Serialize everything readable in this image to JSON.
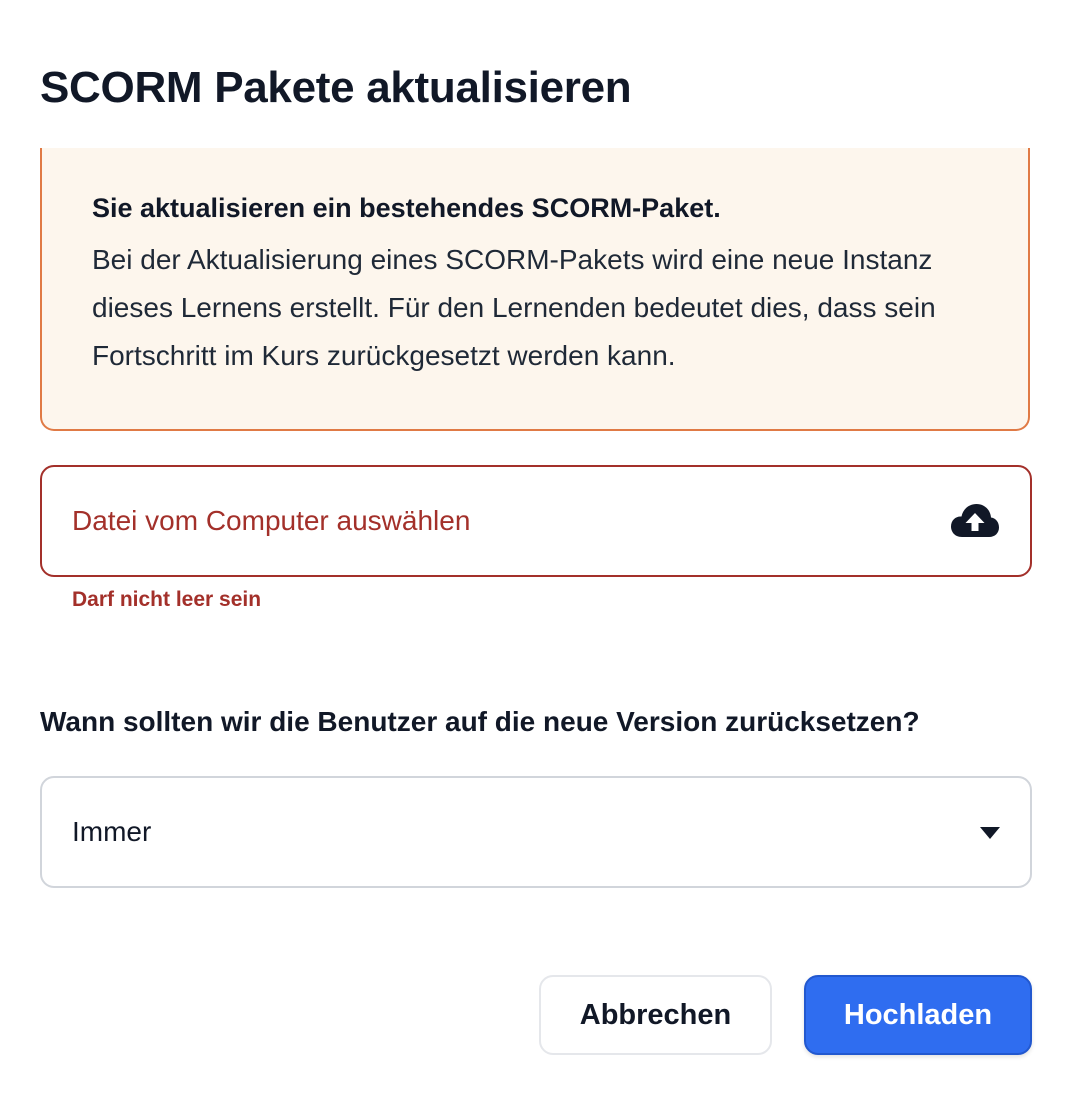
{
  "dialog": {
    "title": "SCORM Pakete aktualisieren"
  },
  "warning": {
    "heading": "Sie aktualisieren ein bestehendes SCORM-Paket.",
    "body": "Bei der Aktualisierung eines SCORM-Pakets wird eine neue Instanz dieses Lernens erstellt. Für den Lernenden bedeutet dies, dass sein Fortschritt im Kurs zurückgesetzt werden kann.",
    "border_color": "#e07a45",
    "background_color": "#fdf6ed"
  },
  "file_field": {
    "placeholder": "Datei vom Computer auswählen",
    "icon": "cloud-upload-icon",
    "error": "Darf nicht leer sein",
    "error_color": "#a3302a"
  },
  "reset_question": {
    "label": "Wann sollten wir die Benutzer auf die neue Version zurücksetzen?",
    "selected": "Immer",
    "icon": "caret-down-icon"
  },
  "actions": {
    "cancel_label": "Abbrechen",
    "upload_label": "Hochladen",
    "primary_color": "#2f6df0"
  }
}
